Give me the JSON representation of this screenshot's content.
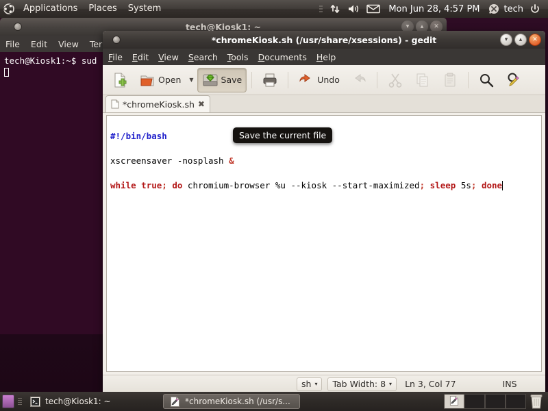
{
  "top_panel": {
    "logo_icon": "ubuntu-logo-icon",
    "menus": [
      {
        "label": "Applications",
        "name": "applications-menu"
      },
      {
        "label": "Places",
        "name": "places-menu"
      },
      {
        "label": "System",
        "name": "system-menu"
      }
    ],
    "tray": [
      {
        "name": "network-icon",
        "glyph": "network"
      },
      {
        "name": "volume-icon",
        "glyph": "volume"
      },
      {
        "name": "mail-icon",
        "glyph": "mail"
      }
    ],
    "clock": "Mon Jun 28,  4:57 PM",
    "user": "tech",
    "user_icon": "user-status-icon",
    "power_icon": "power-icon"
  },
  "terminal": {
    "title": "tech@Kiosk1: ~",
    "menus": [
      "File",
      "Edit",
      "View",
      "Term"
    ],
    "prompt_line": "tech@Kiosk1:~$ sud",
    "background_color": "#300a24",
    "window_buttons": {
      "minimize": "▾",
      "maximize": "▴",
      "close": "✕"
    }
  },
  "gedit": {
    "title": "*chromeKiosk.sh (/usr/share/xsessions) - gedit",
    "window_buttons": {
      "minimize": "▾",
      "maximize": "▴",
      "close": "✕"
    },
    "menus": [
      {
        "label": "File",
        "mnemonic": "F"
      },
      {
        "label": "Edit",
        "mnemonic": "E"
      },
      {
        "label": "View",
        "mnemonic": "V"
      },
      {
        "label": "Search",
        "mnemonic": "S"
      },
      {
        "label": "Tools",
        "mnemonic": "T"
      },
      {
        "label": "Documents",
        "mnemonic": "D"
      },
      {
        "label": "Help",
        "mnemonic": "H"
      }
    ],
    "toolbar": {
      "new_label": "",
      "new_icon": "new-document-icon",
      "open_label": "Open",
      "open_icon": "open-folder-icon",
      "open_dropdown": "▼",
      "save_label": "Save",
      "save_icon": "save-disk-icon",
      "print_icon": "print-icon",
      "undo_label": "Undo",
      "undo_icon": "undo-arrow-icon",
      "redo_icon": "redo-arrow-icon",
      "cut_icon": "cut-scissors-icon",
      "copy_icon": "copy-icon",
      "paste_icon": "paste-clipboard-icon",
      "find_icon": "find-magnifier-icon",
      "replace_icon": "find-replace-icon"
    },
    "tooltip": "Save the current file",
    "tab": {
      "label": "*chromeKiosk.sh",
      "file_icon": "file-icon",
      "close_icon": "✖"
    },
    "editor": {
      "lines": [
        {
          "tokens": [
            {
              "text": "#!/bin/bash",
              "style": "shebang"
            }
          ]
        },
        {
          "tokens": [
            {
              "text": "xscreensaver -nosplash ",
              "style": "plain"
            },
            {
              "text": "&",
              "style": "op"
            }
          ]
        },
        {
          "tokens": [
            {
              "text": "while",
              "style": "kw"
            },
            {
              "text": " ",
              "style": "plain"
            },
            {
              "text": "true",
              "style": "kw"
            },
            {
              "text": ";",
              "style": "op"
            },
            {
              "text": " ",
              "style": "plain"
            },
            {
              "text": "do",
              "style": "kw"
            },
            {
              "text": " chromium-browser %u --kiosk --start-maximized",
              "style": "plain"
            },
            {
              "text": ";",
              "style": "op"
            },
            {
              "text": " ",
              "style": "plain"
            },
            {
              "text": "sleep",
              "style": "kw"
            },
            {
              "text": " 5s",
              "style": "plain"
            },
            {
              "text": ";",
              "style": "op"
            },
            {
              "text": " ",
              "style": "plain"
            },
            {
              "text": "done",
              "style": "kw"
            }
          ]
        }
      ]
    },
    "statusbar": {
      "language": "sh",
      "language_arrow": "▾",
      "tab_width": "Tab Width: 8",
      "tab_width_arrow": "▾",
      "position": "Ln 3, Col 77",
      "insert_mode": "INS"
    }
  },
  "taskbar": {
    "show_desktop_icon": "show-desktop-icon",
    "windows": [
      {
        "label": "tech@Kiosk1: ~",
        "icon": "terminal-icon",
        "active": false
      },
      {
        "label": "*chromeKiosk.sh (/usr/s...",
        "icon": "gedit-icon",
        "active": true
      }
    ],
    "workspaces": [
      {
        "active": true,
        "icon": "gedit-icon"
      },
      {
        "active": false,
        "icon": ""
      },
      {
        "active": false,
        "icon": ""
      },
      {
        "active": false,
        "icon": ""
      }
    ],
    "trash_icon": "trash-icon"
  }
}
